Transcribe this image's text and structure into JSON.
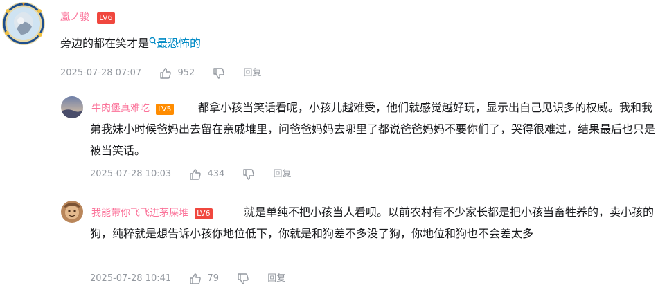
{
  "colors": {
    "username": "#fb7299",
    "lv6": "#f0473e",
    "lv5": "#ff8c00",
    "link": "#008ac5",
    "meta": "#9499a0"
  },
  "comment": {
    "user": "嵐ノ骏",
    "level": "LV6",
    "text_prefix": "旁边的都在笑才是",
    "link_text": "最恐怖的",
    "time": "2025-07-28 07:07",
    "likes": "952",
    "reply_label": "回复"
  },
  "replies": [
    {
      "user": "牛肉堡真难吃",
      "level": "LV5",
      "text": "都拿小孩当笑话看呢，小孩儿越难受，他们就感觉越好玩，显示出自己见识多的权威。我和我弟我妹小时候爸妈出去留在亲戚堆里，问爸爸妈妈去哪里了都说爸爸妈妈不要你们了，哭得很难过，结果最后也只是被当笑话。",
      "time": "2025-07-28 10:03",
      "likes": "434",
      "reply_label": "回复"
    },
    {
      "user": "我能带你飞飞进茅屎堆",
      "level": "LV6",
      "text": "就是单纯不把小孩当人看呗。以前农村有不少家长都是把小孩当畜牲养的，卖小孩的狗，纯粹就是想告诉小孩你地位低下，你就是和狗差不多没了狗，你地位和狗也不会差太多",
      "time": "2025-07-28 10:41",
      "likes": "79",
      "reply_label": "回复"
    }
  ]
}
